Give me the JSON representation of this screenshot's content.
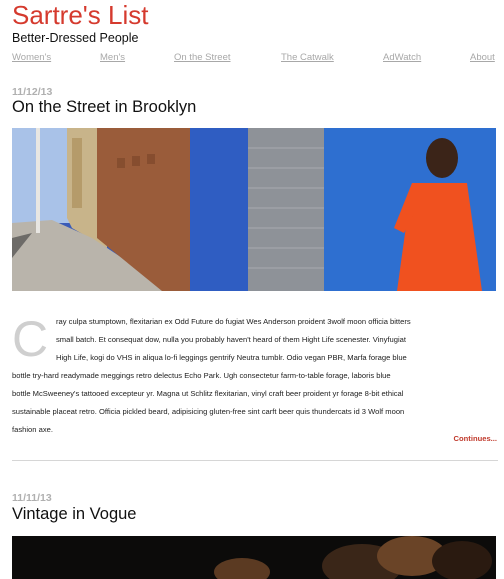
{
  "site": {
    "title": "Sartre's List",
    "tagline": "Better-Dressed People"
  },
  "nav": [
    "Women's",
    "Men's",
    "On the Street",
    "The Catwalk",
    "AdWatch",
    "About"
  ],
  "posts": [
    {
      "date": "11/12/13",
      "title": "On the Street in Brooklyn",
      "dropcap": "C",
      "lines": [
        "ray culpa stumptown, flexitarian ex Odd Future do fugiat Wes Anderson proident 3wolf moon officia bitters",
        "small batch. Et consequat dow, nulla you probably haven't heard of them Hight Life scenester. Vinyfugiat",
        "High Life, kogi do VHS in aliqua lo-fi leggings gentrify Neutra tumblr. Odio vegan PBR, Marfa forage blue",
        "bottle try-hard readymade meggings retro delectus Echo Park. Ugh consectetur farm-to-table forage, laboris blue",
        "bottle McSweeney's tattooed excepteur yr. Magna ut Schlitz flexitarian, vinyl craft beer proident yr forage 8-bit ethical",
        "sustainable placeat retro. Officia pickled beard, adipisicing gluten-free sint carft beer quis thundercats id 3 Wolf moon",
        "fashion axe."
      ],
      "continue_label": "Continues..."
    },
    {
      "date": "11/11/13",
      "title": "Vintage in Vogue"
    }
  ],
  "colors": {
    "accent": "#d53a2e",
    "muted": "#a8a8a8"
  }
}
